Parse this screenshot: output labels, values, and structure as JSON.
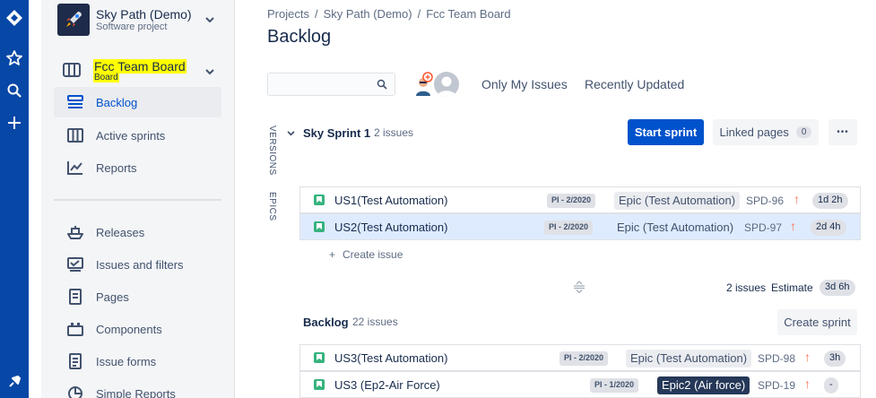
{
  "global_nav": {
    "icons": [
      "jira-logo-icon",
      "star-icon",
      "search-icon",
      "plus-icon",
      "feedback-icon"
    ]
  },
  "project": {
    "name": "Sky Path (Demo)",
    "type": "Software project"
  },
  "board": {
    "name": "Fcc Team Board",
    "type": "Board"
  },
  "sidebar": {
    "items": [
      {
        "label": "Backlog",
        "active": true
      },
      {
        "label": "Active sprints"
      },
      {
        "label": "Reports"
      },
      {
        "label": "Releases"
      },
      {
        "label": "Issues and filters"
      },
      {
        "label": "Pages"
      },
      {
        "label": "Components"
      },
      {
        "label": "Issue forms"
      },
      {
        "label": "Simple Reports"
      }
    ]
  },
  "breadcrumbs": [
    "Projects",
    "Sky Path (Demo)",
    "Fcc Team Board"
  ],
  "page_title": "Backlog",
  "search": {
    "value": "",
    "placeholder": ""
  },
  "quick_filters": [
    "Only My Issues",
    "Recently Updated"
  ],
  "side_tabs": [
    "VERSIONS",
    "EPICS"
  ],
  "sprint": {
    "name": "Sky Sprint 1",
    "count": "2 issues",
    "start_label": "Start sprint",
    "linked_label": "Linked pages",
    "linked_count": "0",
    "more_label": "•••",
    "issues": [
      {
        "summary": "US1(Test Automation)",
        "pi": "PI - 2/2020",
        "epic": "Epic (Test Automation)",
        "key": "SPD-96",
        "estimate": "1d 2h"
      },
      {
        "summary": "US2(Test Automation)",
        "pi": "PI - 2/2020",
        "epic": "Epic (Test Automation)",
        "key": "SPD-97",
        "estimate": "2d 4h"
      }
    ],
    "create_label": "Create issue",
    "footer_count": "2 issues",
    "footer_estimate_label": "Estimate",
    "footer_estimate": "3d 6h"
  },
  "backlog": {
    "name": "Backlog",
    "count": "22 issues",
    "create_sprint_label": "Create sprint",
    "issues": [
      {
        "summary": "US3(Test Automation)",
        "pi": "PI - 2/2020",
        "epic": "Epic (Test Automation)",
        "key": "SPD-98",
        "estimate": "3h"
      },
      {
        "summary": "US3 (Ep2-Air Force)",
        "pi": "PI - 1/2020",
        "epic": "Epic2 (Air force)",
        "key": "SPD-19",
        "estimate": "-"
      }
    ]
  },
  "colors": {
    "nav": "#0747A6",
    "primary": "#0052CC",
    "highlight": "#FFFF00",
    "story": "#36B37E",
    "priority_high": "#FF7452"
  }
}
